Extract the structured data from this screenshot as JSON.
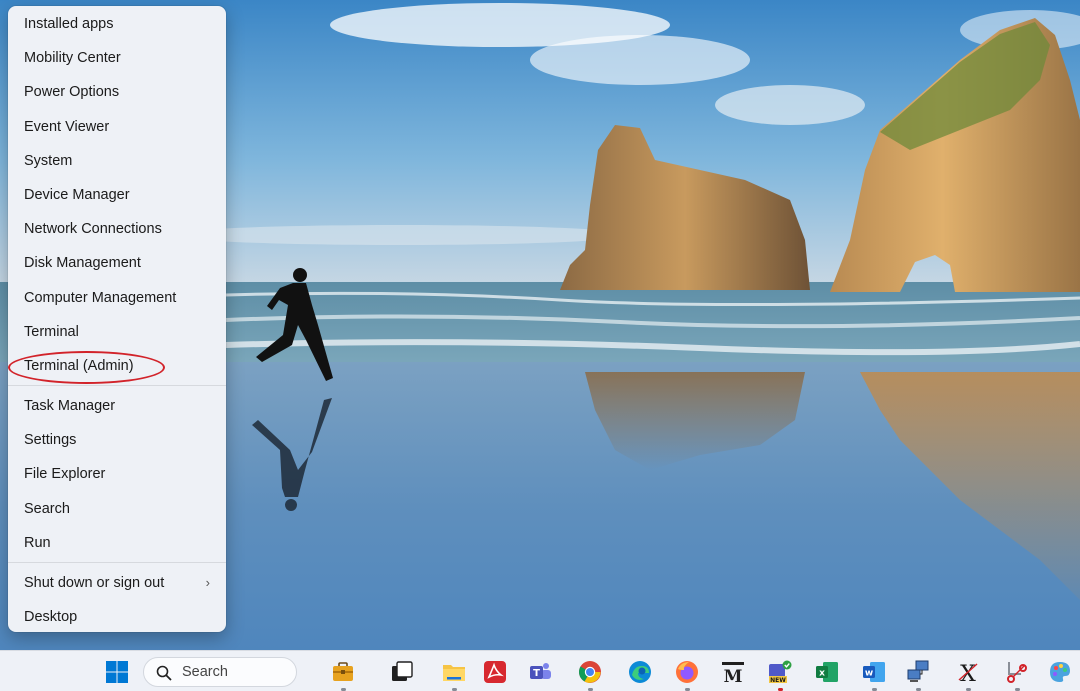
{
  "menu": {
    "items": [
      {
        "label": "Installed apps"
      },
      {
        "label": "Mobility Center"
      },
      {
        "label": "Power Options"
      },
      {
        "label": "Event Viewer"
      },
      {
        "label": "System"
      },
      {
        "label": "Device Manager"
      },
      {
        "label": "Network Connections"
      },
      {
        "label": "Disk Management"
      },
      {
        "label": "Computer Management"
      },
      {
        "label": "Terminal"
      },
      {
        "label": "Terminal (Admin)"
      },
      {
        "label": "Task Manager"
      },
      {
        "label": "Settings"
      },
      {
        "label": "File Explorer"
      },
      {
        "label": "Search"
      },
      {
        "label": "Run"
      },
      {
        "label": "Shut down or sign out",
        "chevron": "›"
      },
      {
        "label": "Desktop"
      }
    ],
    "highlighted": "Terminal (Admin)",
    "highlight_color": "#d2232a"
  },
  "taskbar": {
    "search_label": "Search",
    "accent_color": "#005fb8",
    "apps": [
      {
        "icon": "start-windows-icon"
      },
      {
        "icon": "search-icon"
      },
      {
        "icon": "briefcase-icon"
      },
      {
        "icon": "task-view-icon"
      },
      {
        "icon": "file-explorer-icon"
      },
      {
        "icon": "acrobat-reader-icon"
      },
      {
        "icon": "teams-icon"
      },
      {
        "icon": "chrome-icon"
      },
      {
        "icon": "edge-icon"
      },
      {
        "icon": "firefox-icon"
      },
      {
        "icon": "m-app-icon",
        "text": "M"
      },
      {
        "icon": "teams-new-icon",
        "text": "NEW"
      },
      {
        "icon": "excel-icon",
        "text": "x"
      },
      {
        "icon": "word-icon",
        "text": "w"
      },
      {
        "icon": "network-computers-icon"
      },
      {
        "icon": "x-app-icon",
        "text": "X"
      },
      {
        "icon": "snipping-tool-icon"
      },
      {
        "icon": "paint-icon"
      }
    ]
  }
}
